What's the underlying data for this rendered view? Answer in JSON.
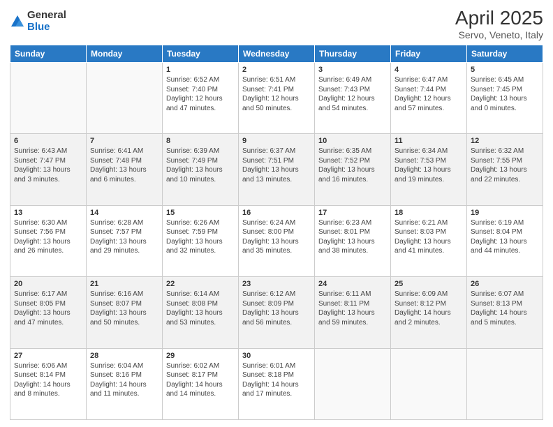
{
  "logo": {
    "general": "General",
    "blue": "Blue"
  },
  "header": {
    "title": "April 2025",
    "subtitle": "Servo, Veneto, Italy"
  },
  "weekdays": [
    "Sunday",
    "Monday",
    "Tuesday",
    "Wednesday",
    "Thursday",
    "Friday",
    "Saturday"
  ],
  "weeks": [
    [
      {
        "day": "",
        "detail": ""
      },
      {
        "day": "",
        "detail": ""
      },
      {
        "day": "1",
        "detail": "Sunrise: 6:52 AM\nSunset: 7:40 PM\nDaylight: 12 hours and 47 minutes."
      },
      {
        "day": "2",
        "detail": "Sunrise: 6:51 AM\nSunset: 7:41 PM\nDaylight: 12 hours and 50 minutes."
      },
      {
        "day": "3",
        "detail": "Sunrise: 6:49 AM\nSunset: 7:43 PM\nDaylight: 12 hours and 54 minutes."
      },
      {
        "day": "4",
        "detail": "Sunrise: 6:47 AM\nSunset: 7:44 PM\nDaylight: 12 hours and 57 minutes."
      },
      {
        "day": "5",
        "detail": "Sunrise: 6:45 AM\nSunset: 7:45 PM\nDaylight: 13 hours and 0 minutes."
      }
    ],
    [
      {
        "day": "6",
        "detail": "Sunrise: 6:43 AM\nSunset: 7:47 PM\nDaylight: 13 hours and 3 minutes."
      },
      {
        "day": "7",
        "detail": "Sunrise: 6:41 AM\nSunset: 7:48 PM\nDaylight: 13 hours and 6 minutes."
      },
      {
        "day": "8",
        "detail": "Sunrise: 6:39 AM\nSunset: 7:49 PM\nDaylight: 13 hours and 10 minutes."
      },
      {
        "day": "9",
        "detail": "Sunrise: 6:37 AM\nSunset: 7:51 PM\nDaylight: 13 hours and 13 minutes."
      },
      {
        "day": "10",
        "detail": "Sunrise: 6:35 AM\nSunset: 7:52 PM\nDaylight: 13 hours and 16 minutes."
      },
      {
        "day": "11",
        "detail": "Sunrise: 6:34 AM\nSunset: 7:53 PM\nDaylight: 13 hours and 19 minutes."
      },
      {
        "day": "12",
        "detail": "Sunrise: 6:32 AM\nSunset: 7:55 PM\nDaylight: 13 hours and 22 minutes."
      }
    ],
    [
      {
        "day": "13",
        "detail": "Sunrise: 6:30 AM\nSunset: 7:56 PM\nDaylight: 13 hours and 26 minutes."
      },
      {
        "day": "14",
        "detail": "Sunrise: 6:28 AM\nSunset: 7:57 PM\nDaylight: 13 hours and 29 minutes."
      },
      {
        "day": "15",
        "detail": "Sunrise: 6:26 AM\nSunset: 7:59 PM\nDaylight: 13 hours and 32 minutes."
      },
      {
        "day": "16",
        "detail": "Sunrise: 6:24 AM\nSunset: 8:00 PM\nDaylight: 13 hours and 35 minutes."
      },
      {
        "day": "17",
        "detail": "Sunrise: 6:23 AM\nSunset: 8:01 PM\nDaylight: 13 hours and 38 minutes."
      },
      {
        "day": "18",
        "detail": "Sunrise: 6:21 AM\nSunset: 8:03 PM\nDaylight: 13 hours and 41 minutes."
      },
      {
        "day": "19",
        "detail": "Sunrise: 6:19 AM\nSunset: 8:04 PM\nDaylight: 13 hours and 44 minutes."
      }
    ],
    [
      {
        "day": "20",
        "detail": "Sunrise: 6:17 AM\nSunset: 8:05 PM\nDaylight: 13 hours and 47 minutes."
      },
      {
        "day": "21",
        "detail": "Sunrise: 6:16 AM\nSunset: 8:07 PM\nDaylight: 13 hours and 50 minutes."
      },
      {
        "day": "22",
        "detail": "Sunrise: 6:14 AM\nSunset: 8:08 PM\nDaylight: 13 hours and 53 minutes."
      },
      {
        "day": "23",
        "detail": "Sunrise: 6:12 AM\nSunset: 8:09 PM\nDaylight: 13 hours and 56 minutes."
      },
      {
        "day": "24",
        "detail": "Sunrise: 6:11 AM\nSunset: 8:11 PM\nDaylight: 13 hours and 59 minutes."
      },
      {
        "day": "25",
        "detail": "Sunrise: 6:09 AM\nSunset: 8:12 PM\nDaylight: 14 hours and 2 minutes."
      },
      {
        "day": "26",
        "detail": "Sunrise: 6:07 AM\nSunset: 8:13 PM\nDaylight: 14 hours and 5 minutes."
      }
    ],
    [
      {
        "day": "27",
        "detail": "Sunrise: 6:06 AM\nSunset: 8:14 PM\nDaylight: 14 hours and 8 minutes."
      },
      {
        "day": "28",
        "detail": "Sunrise: 6:04 AM\nSunset: 8:16 PM\nDaylight: 14 hours and 11 minutes."
      },
      {
        "day": "29",
        "detail": "Sunrise: 6:02 AM\nSunset: 8:17 PM\nDaylight: 14 hours and 14 minutes."
      },
      {
        "day": "30",
        "detail": "Sunrise: 6:01 AM\nSunset: 8:18 PM\nDaylight: 14 hours and 17 minutes."
      },
      {
        "day": "",
        "detail": ""
      },
      {
        "day": "",
        "detail": ""
      },
      {
        "day": "",
        "detail": ""
      }
    ]
  ]
}
